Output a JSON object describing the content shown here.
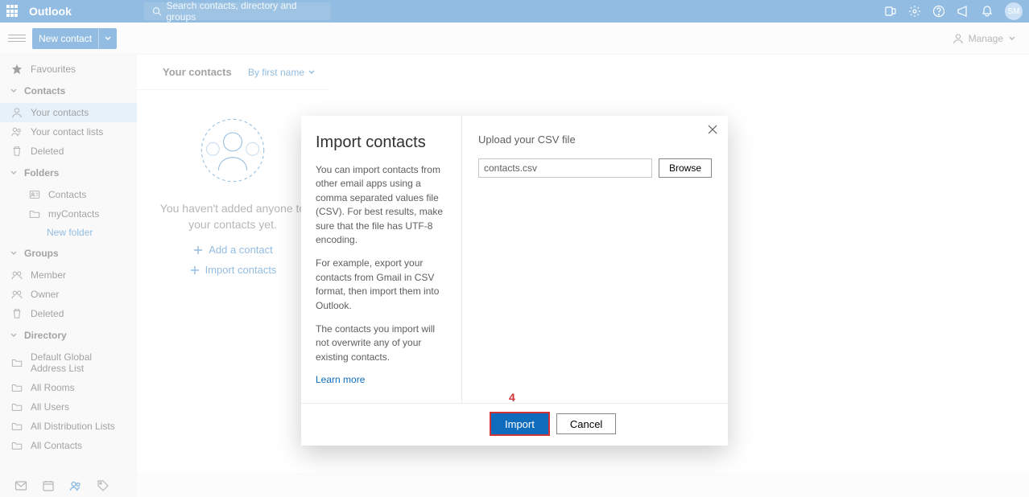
{
  "header": {
    "brand": "Outlook",
    "search_placeholder": "Search contacts, directory and groups",
    "avatar_initials": "SM"
  },
  "commandbar": {
    "new_contact": "New contact",
    "manage": "Manage"
  },
  "sidebar": {
    "favourites": "Favourites",
    "contacts_head": "Contacts",
    "your_contacts": "Your contacts",
    "your_contact_lists": "Your contact lists",
    "deleted": "Deleted",
    "folders_head": "Folders",
    "folder_contacts": "Contacts",
    "folder_mycontacts": "myContacts",
    "new_folder": "New folder",
    "groups_head": "Groups",
    "member": "Member",
    "owner": "Owner",
    "groups_deleted": "Deleted",
    "directory_head": "Directory",
    "dir_gal": "Default Global Address List",
    "dir_rooms": "All Rooms",
    "dir_users": "All Users",
    "dir_dl": "All Distribution Lists",
    "dir_contacts": "All Contacts"
  },
  "column2": {
    "title": "Your contacts",
    "sort_by": "By first name",
    "empty_msg": "You haven't added anyone to your contacts yet.",
    "add_contact": "Add a contact",
    "import_contacts": "Import contacts"
  },
  "dialog": {
    "title": "Import contacts",
    "para1": "You can import contacts from other email apps using a comma separated values file (CSV). For best results, make sure that the file has UTF-8 encoding.",
    "para2": "For example, export your contacts from Gmail in CSV format, then import them into Outlook.",
    "para3": "The contacts you import will not overwrite any of your existing contacts.",
    "learn_more": "Learn more",
    "upload_label": "Upload your CSV file",
    "file_value": "contacts.csv",
    "browse": "Browse",
    "import_btn": "Import",
    "cancel_btn": "Cancel",
    "callout_number": "4"
  }
}
